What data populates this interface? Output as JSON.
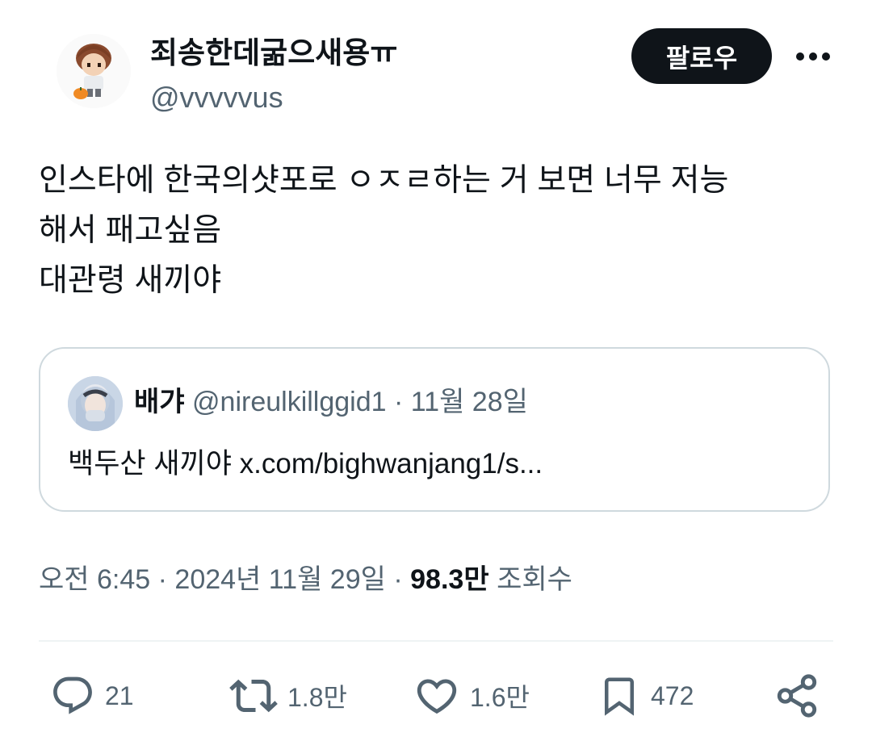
{
  "header": {
    "display_name": "죄송한데굶으새용ㅠ",
    "handle": "@vvvvvus",
    "follow_label": "팔로우",
    "more_icon": "more-icon"
  },
  "tweet": {
    "lines": [
      "인스타에 한국의샷포로 ㅇㅈㄹ하는 거 보면 너무 저능",
      "해서 패고싶음",
      "대관령 새끼야"
    ]
  },
  "quote": {
    "name": "배갸",
    "handle": "@nireulkillggid1",
    "separator": "·",
    "date": "11월 28일",
    "text": "백두산 새끼야 x.com/bighwanjang1/s..."
  },
  "meta": {
    "time": "오전 6:45",
    "sep1": "·",
    "date": "2024년 11월 29일",
    "sep2": "·",
    "views_count": "98.3만",
    "views_label": "조회수"
  },
  "actions": {
    "reply": {
      "icon": "reply-icon",
      "count": "21"
    },
    "retweet": {
      "icon": "retweet-icon",
      "count": "1.8만"
    },
    "like": {
      "icon": "heart-icon",
      "count": "1.6만"
    },
    "bookmark": {
      "icon": "bookmark-icon",
      "count": "472"
    },
    "share": {
      "icon": "share-icon"
    }
  },
  "colors": {
    "text": "#0f1419",
    "secondary": "#536471",
    "border": "#cfd9de",
    "button_bg": "#0f1419"
  }
}
